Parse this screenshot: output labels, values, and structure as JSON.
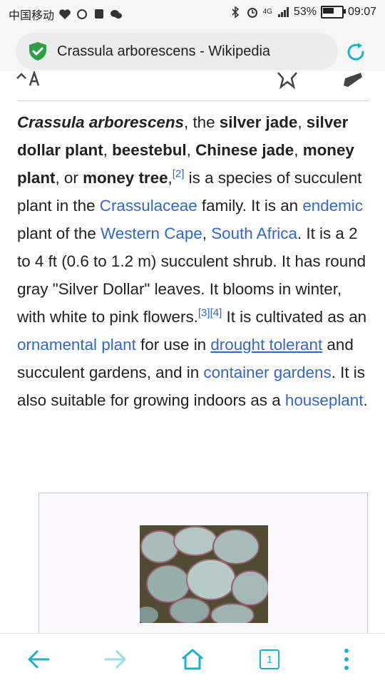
{
  "status_bar": {
    "carrier": "中国移动",
    "battery_level": "53%",
    "network": "4G",
    "time": "09:07"
  },
  "browser": {
    "page_title": "Crassula arborescens - Wikipedia",
    "accent_color": "#1ab2c8"
  },
  "article": {
    "s1_title_italic": "Crassula arborescens",
    "s1_comma_the": ", the ",
    "alt_name_1": "silver jade",
    "comma_1": ", ",
    "alt_name_2": "silver dollar plant",
    "comma_2": ", ",
    "alt_name_3": "beestebul",
    "comma_3": ", ",
    "alt_name_4": "Chinese jade",
    "comma_4": ", ",
    "alt_name_5": "money plant",
    "or_text": ", or ",
    "alt_name_6": "money tree",
    "comma_5": ",",
    "ref_2": "[2]",
    "t_species": " is a species of succulent plant in the ",
    "link_crassulaceae": "Crassulaceae",
    "t_family": " family. It is an ",
    "link_endemic": "endemic",
    "t_plant_of": " plant of the ",
    "link_western_cape": "Western Cape",
    "comma_6": ", ",
    "link_south_africa": "South Africa",
    "t_size": ". It is a 2 to 4 ft (0.6 to 1.2 m) succulent shrub. It has round gray \"Silver Dollar\" leaves. It blooms in winter, with white to pink flowers.",
    "ref_3": "[3]",
    "ref_4": "[4]",
    "t_cultivated": " It is cultivated as an ",
    "link_ornamental": "ornamental plant",
    "t_for_use": " for use in ",
    "link_drought": "drought tolerant",
    "t_gardens": " and succulent gardens, and in ",
    "link_container": "container gardens",
    "t_suitable": ". It is also suitable for growing indoors as a ",
    "link_houseplant": "houseplant",
    "t_end": "."
  },
  "icons": {
    "back": "back-arrow-icon",
    "forward": "forward-arrow-icon",
    "home": "home-icon",
    "tabs": "tabs-icon",
    "menu": "more-menu-icon"
  },
  "nav": {
    "tab_count": "1"
  }
}
